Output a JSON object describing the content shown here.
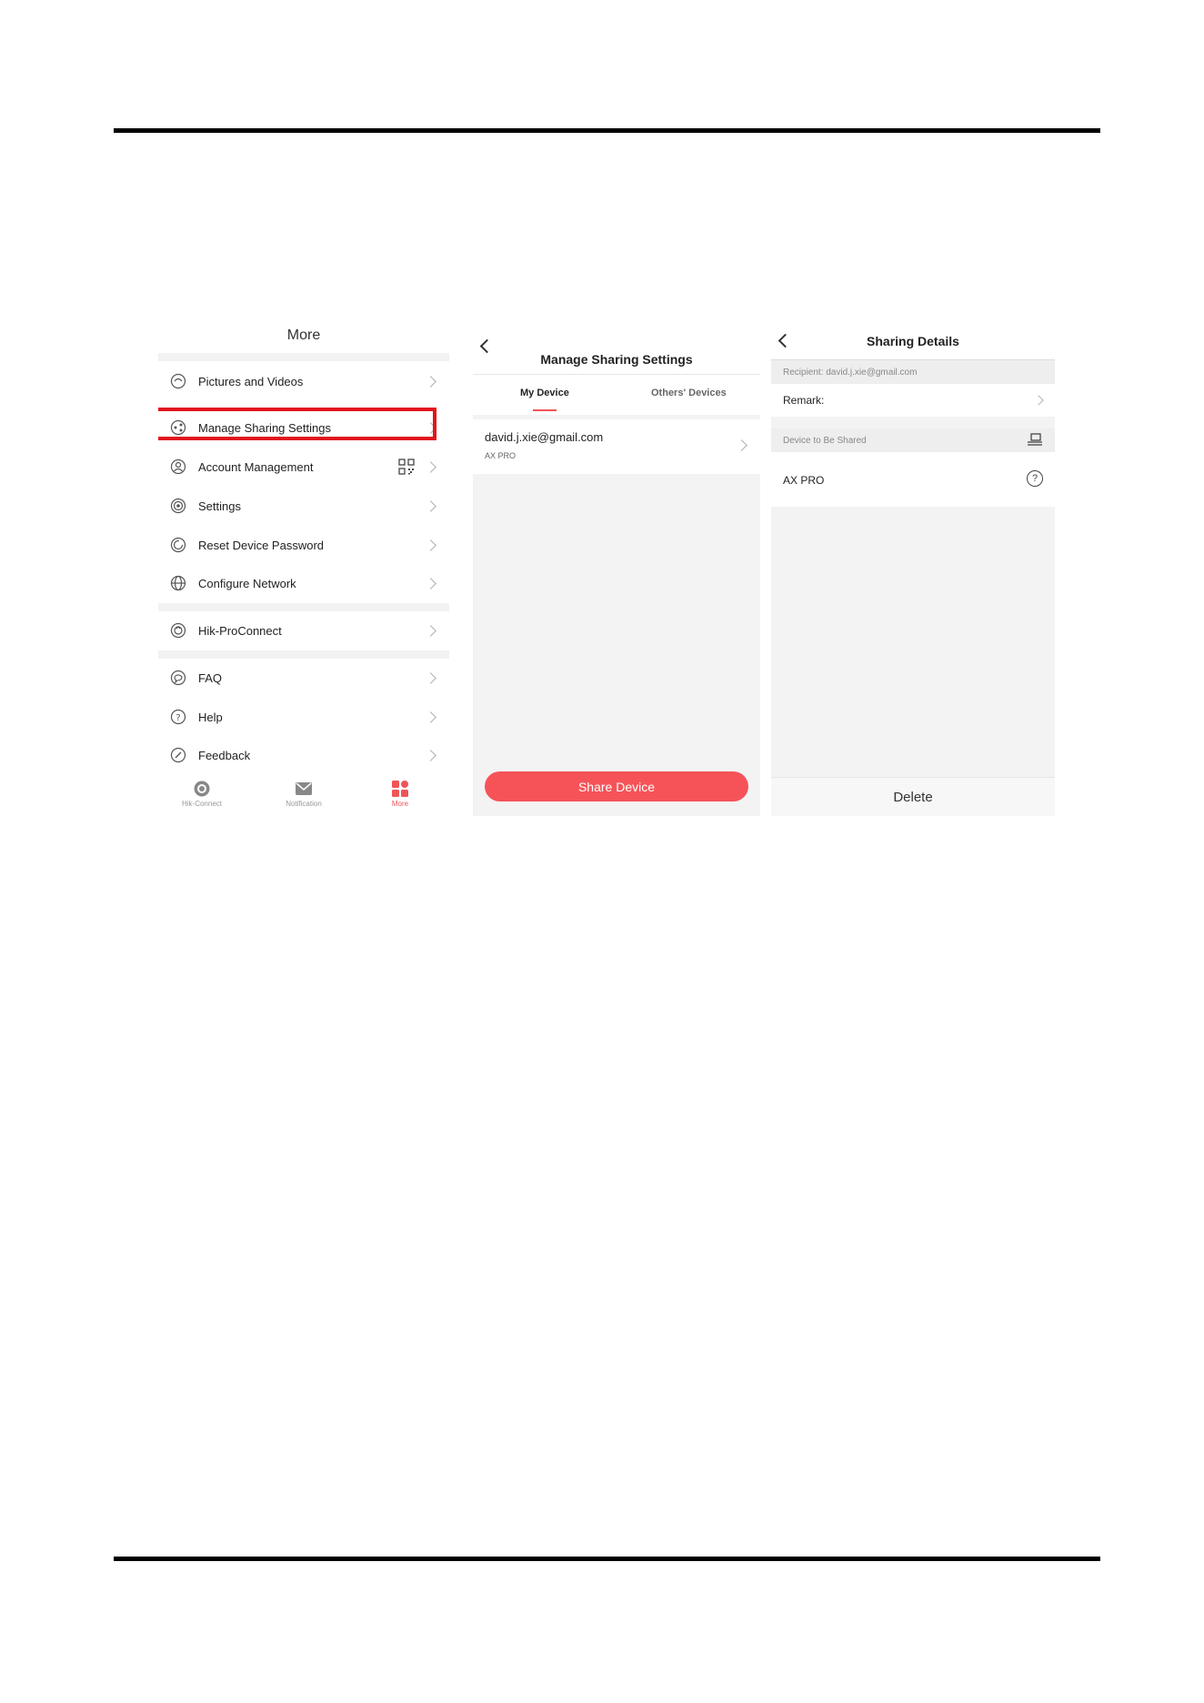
{
  "more_screen": {
    "title": "More",
    "menu_items": [
      {
        "label": "Pictures and Videos",
        "icon": "pictures-icon"
      },
      {
        "label": "Manage Sharing Settings",
        "icon": "share-icon"
      },
      {
        "label": "Account Management",
        "icon": "account-icon"
      },
      {
        "label": "Settings",
        "icon": "settings-icon"
      },
      {
        "label": "Reset Device Password",
        "icon": "reset-password-icon"
      },
      {
        "label": "Configure Network",
        "icon": "globe-icon"
      },
      {
        "label": "Hik-ProConnect",
        "icon": "proconnect-icon"
      },
      {
        "label": "FAQ",
        "icon": "faq-icon"
      },
      {
        "label": "Help",
        "icon": "help-icon"
      },
      {
        "label": "Feedback",
        "icon": "feedback-icon"
      }
    ],
    "tabbar": [
      {
        "label": "Hik-Connect",
        "icon": "hik-connect-icon"
      },
      {
        "label": "Notification",
        "icon": "envelope-icon"
      },
      {
        "label": "More",
        "icon": "grid-icon"
      }
    ]
  },
  "manage_screen": {
    "title": "Manage Sharing Settings",
    "tabs": {
      "my_device": "My Device",
      "others_devices": "Others' Devices"
    },
    "share_entry": {
      "email": "david.j.xie@gmail.com",
      "device": "AX PRO"
    },
    "share_button": "Share Device"
  },
  "details_screen": {
    "title": "Sharing Details",
    "recipient": "Recipient: david.j.xie@gmail.com",
    "remark_label": "Remark:",
    "device_section": "Device to Be Shared",
    "device_name": "AX PRO",
    "delete_label": "Delete"
  },
  "colors": {
    "accent": "#f55358",
    "highlight_box": "#e0161c"
  }
}
